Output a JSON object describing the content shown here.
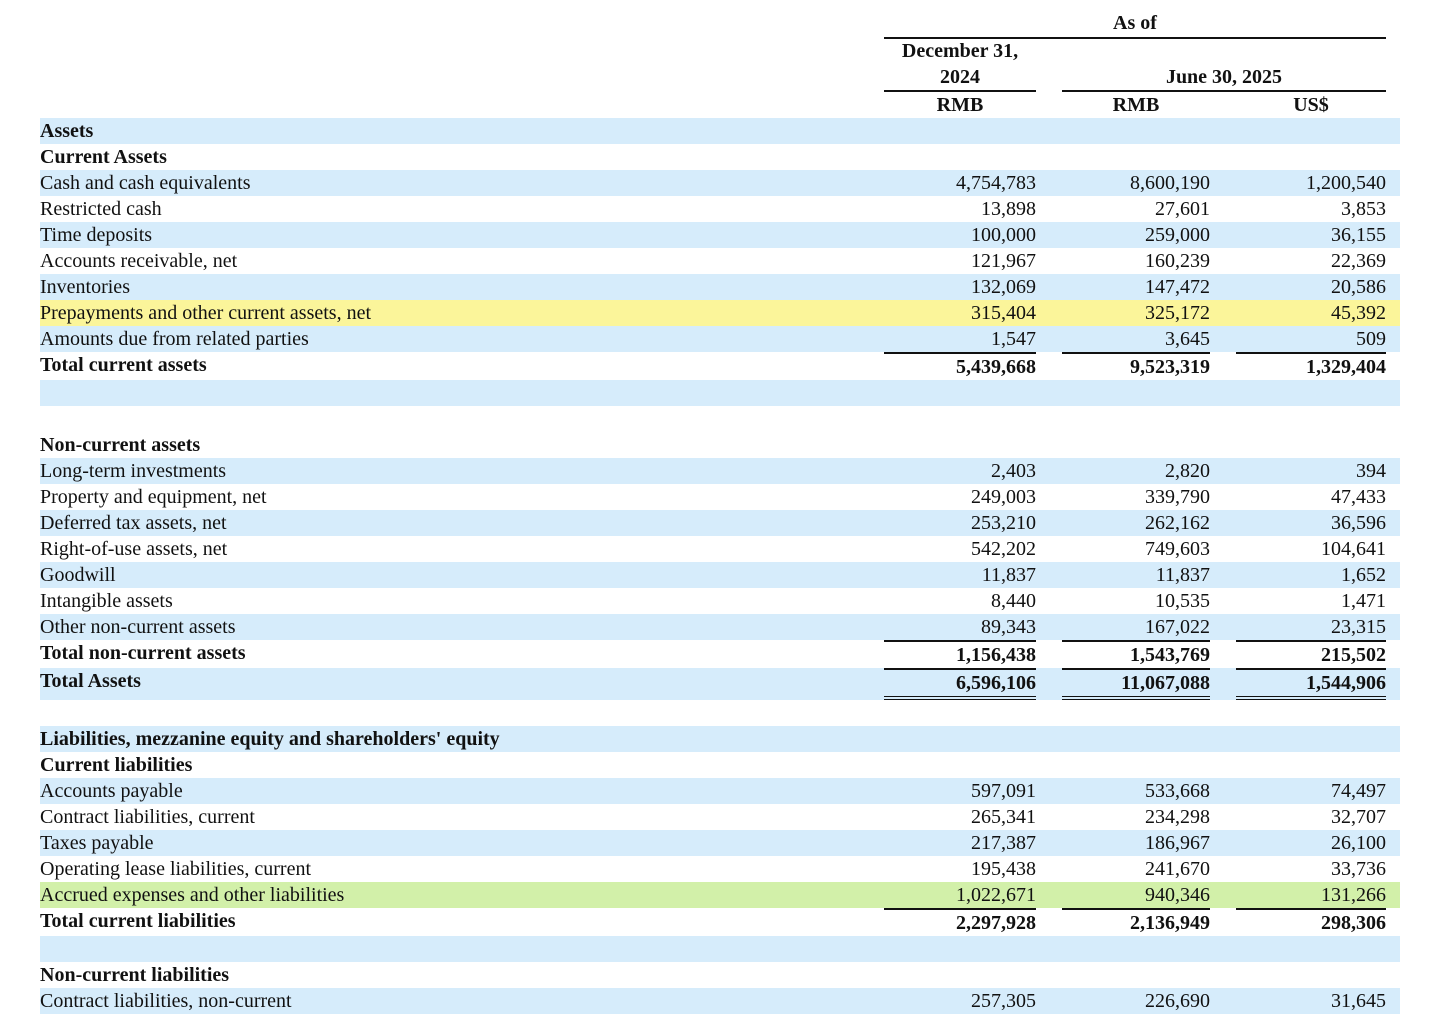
{
  "header": {
    "as_of": "As of",
    "col1_date": "December 31, 2024",
    "col1_date_l1": "December 31,",
    "col1_date_l2": "2024",
    "col1_currency": "RMB",
    "col23_date": "June 30, 2025",
    "col2_currency": "RMB",
    "col3_currency": "US$"
  },
  "rows": [
    {
      "label": "Assets",
      "v": [
        "",
        "",
        ""
      ],
      "style": "bold",
      "bg": "blue"
    },
    {
      "label": "Current Assets",
      "v": [
        "",
        "",
        ""
      ],
      "style": "bold",
      "bg": "white"
    },
    {
      "label": "Cash and cash equivalents",
      "v": [
        "4,754,783",
        "8,600,190",
        "1,200,540"
      ],
      "style": "normal",
      "bg": "blue"
    },
    {
      "label": "Restricted cash",
      "v": [
        "13,898",
        "27,601",
        "3,853"
      ],
      "style": "normal",
      "bg": "white"
    },
    {
      "label": "Time deposits",
      "v": [
        "100,000",
        "259,000",
        "36,155"
      ],
      "style": "normal",
      "bg": "blue"
    },
    {
      "label": "Accounts receivable, net",
      "v": [
        "121,967",
        "160,239",
        "22,369"
      ],
      "style": "normal",
      "bg": "white"
    },
    {
      "label": "Inventories",
      "v": [
        "132,069",
        "147,472",
        "20,586"
      ],
      "style": "normal",
      "bg": "blue"
    },
    {
      "label": "Prepayments and other current assets, net",
      "v": [
        "315,404",
        "325,172",
        "45,392"
      ],
      "style": "normal",
      "bg": "yellow"
    },
    {
      "label": "Amounts due from related parties",
      "v": [
        "1,547",
        "3,645",
        "509"
      ],
      "style": "normal",
      "bg": "blue"
    },
    {
      "label": "Total current assets",
      "v": [
        "5,439,668",
        "9,523,319",
        "1,329,404"
      ],
      "style": "total",
      "bg": "white"
    },
    {
      "label": "",
      "v": [
        "",
        "",
        ""
      ],
      "style": "normal",
      "bg": "blue"
    },
    {
      "label": "",
      "v": [
        "",
        "",
        ""
      ],
      "style": "normal",
      "bg": "white"
    },
    {
      "label": "Non-current assets",
      "v": [
        "",
        "",
        ""
      ],
      "style": "bold",
      "bg": "white"
    },
    {
      "label": "Long-term investments",
      "v": [
        "2,403",
        "2,820",
        "394"
      ],
      "style": "normal",
      "bg": "blue"
    },
    {
      "label": "Property and equipment, net",
      "v": [
        "249,003",
        "339,790",
        "47,433"
      ],
      "style": "normal",
      "bg": "white"
    },
    {
      "label": "Deferred tax assets, net",
      "v": [
        "253,210",
        "262,162",
        "36,596"
      ],
      "style": "normal",
      "bg": "blue"
    },
    {
      "label": "Right-of-use assets, net",
      "v": [
        "542,202",
        "749,603",
        "104,641"
      ],
      "style": "normal",
      "bg": "white"
    },
    {
      "label": "Goodwill",
      "v": [
        "11,837",
        "11,837",
        "1,652"
      ],
      "style": "normal",
      "bg": "blue"
    },
    {
      "label": "Intangible assets",
      "v": [
        "8,440",
        "10,535",
        "1,471"
      ],
      "style": "normal",
      "bg": "white"
    },
    {
      "label": "Other non-current assets",
      "v": [
        "89,343",
        "167,022",
        "23,315"
      ],
      "style": "normal",
      "bg": "blue"
    },
    {
      "label": "Total non-current assets",
      "v": [
        "1,156,438",
        "1,543,769",
        "215,502"
      ],
      "style": "total",
      "bg": "white"
    },
    {
      "label": "Total Assets",
      "v": [
        "6,596,106",
        "11,067,088",
        "1,544,906"
      ],
      "style": "grand",
      "bg": "blue"
    },
    {
      "label": "",
      "v": [
        "",
        "",
        ""
      ],
      "style": "normal",
      "bg": "white"
    },
    {
      "label": "Liabilities, mezzanine equity and shareholders' equity",
      "v": [
        "",
        "",
        ""
      ],
      "style": "bold",
      "bg": "blue"
    },
    {
      "label": "Current liabilities",
      "v": [
        "",
        "",
        ""
      ],
      "style": "bold",
      "bg": "white"
    },
    {
      "label": "Accounts payable",
      "v": [
        "597,091",
        "533,668",
        "74,497"
      ],
      "style": "normal",
      "bg": "blue"
    },
    {
      "label": "Contract liabilities, current",
      "v": [
        "265,341",
        "234,298",
        "32,707"
      ],
      "style": "normal",
      "bg": "white"
    },
    {
      "label": "Taxes payable",
      "v": [
        "217,387",
        "186,967",
        "26,100"
      ],
      "style": "normal",
      "bg": "blue"
    },
    {
      "label": "Operating lease liabilities, current",
      "v": [
        "195,438",
        "241,670",
        "33,736"
      ],
      "style": "normal",
      "bg": "white"
    },
    {
      "label": "Accrued expenses and other liabilities",
      "v": [
        "1,022,671",
        "940,346",
        "131,266"
      ],
      "style": "normal",
      "bg": "green"
    },
    {
      "label": "Total current liabilities",
      "v": [
        "2,297,928",
        "2,136,949",
        "298,306"
      ],
      "style": "total",
      "bg": "white"
    },
    {
      "label": "",
      "v": [
        "",
        "",
        ""
      ],
      "style": "normal",
      "bg": "blue"
    },
    {
      "label": "Non-current liabilities",
      "v": [
        "",
        "",
        ""
      ],
      "style": "bold",
      "bg": "white"
    },
    {
      "label": "Contract liabilities, non-current",
      "v": [
        "257,305",
        "226,690",
        "31,645"
      ],
      "style": "normal",
      "bg": "blue"
    }
  ]
}
